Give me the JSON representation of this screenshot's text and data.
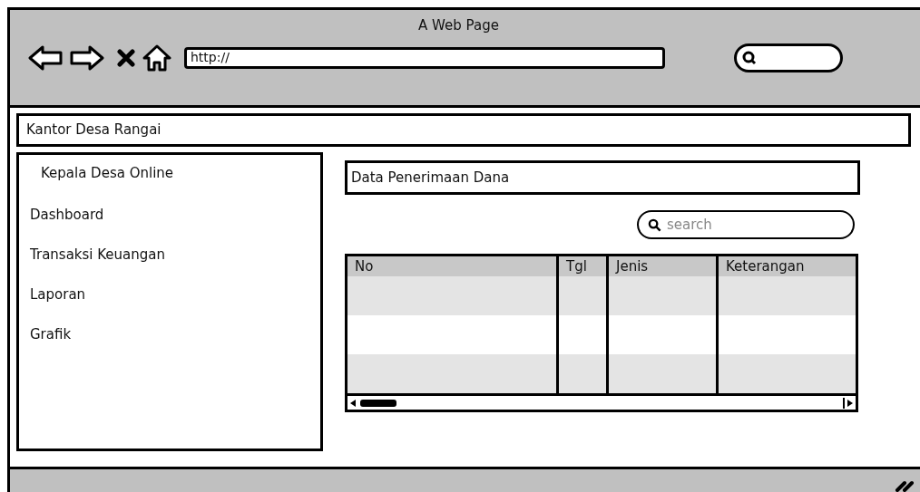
{
  "window": {
    "title": "A Web Page"
  },
  "browser": {
    "url": "http://"
  },
  "header": {
    "title": "Kantor Desa Rangai"
  },
  "sidebar": {
    "title": "Kepala Desa Online",
    "items": [
      "Dashboard",
      "Transaksi Keuangan",
      "Laporan",
      "Grafik"
    ]
  },
  "content": {
    "title": "Data Penerimaan Dana",
    "search": {
      "placeholder": "search"
    }
  },
  "table": {
    "columns": [
      "No",
      "Tgl",
      "Jenis",
      "Keterangan"
    ],
    "rows": [
      {
        "shaded": true
      },
      {
        "shaded": false
      },
      {
        "shaded": true
      }
    ]
  }
}
